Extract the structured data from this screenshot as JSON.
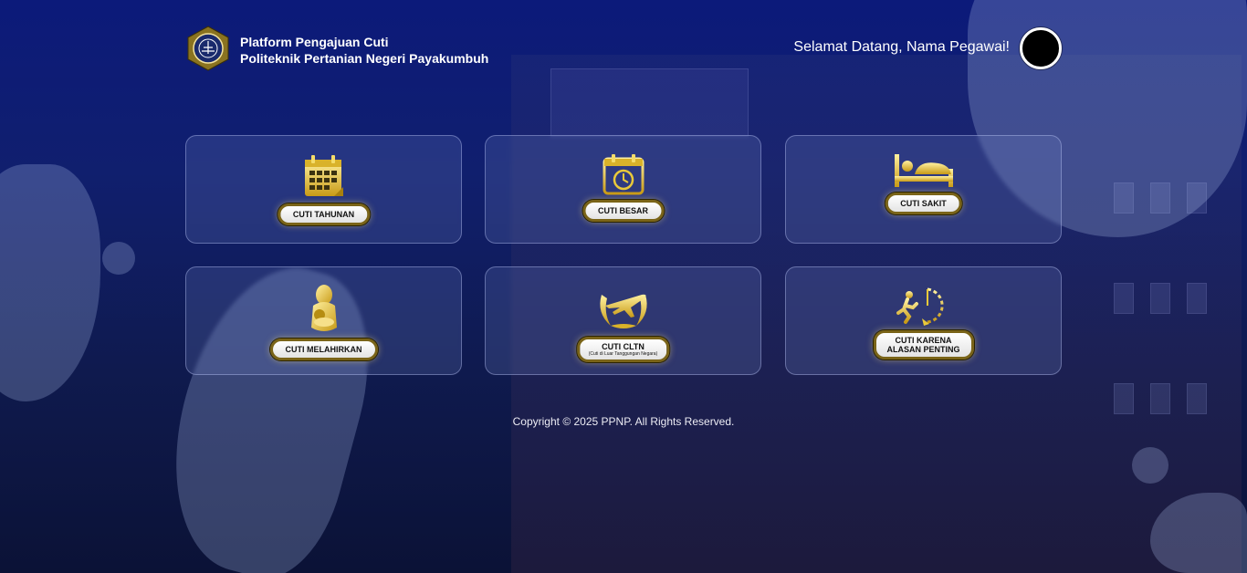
{
  "header": {
    "brand_line1": "Platform Pengajuan Cuti",
    "brand_line2": "Politeknik Pertanian Negeri Payakumbuh",
    "welcome": "Selamat Datang, Nama Pegawai!"
  },
  "menu": [
    {
      "label": "CUTI TAHUNAN",
      "icon": "calendar-grid-icon"
    },
    {
      "label": "CUTI BESAR",
      "icon": "calendar-clock-icon"
    },
    {
      "label": "CUTI SAKIT",
      "icon": "bed-icon"
    },
    {
      "label": "CUTI MELAHIRKAN",
      "icon": "mother-baby-icon"
    },
    {
      "label": "CUTI CLTN",
      "sublabel": "(Cuti di Luar Tanggungan Negara)",
      "icon": "airplane-wreath-icon"
    },
    {
      "label_line1": "CUTI KARENA",
      "label_line2": "ALASAN PENTING",
      "icon": "running-clock-icon"
    }
  ],
  "footer": {
    "copyright": "Copyright © 2025 PPNP. All Rights Reserved."
  },
  "colors": {
    "background_top": "#0c1a7a",
    "icon_gold": "#e9c93a",
    "pill_border": "#7a6418"
  }
}
